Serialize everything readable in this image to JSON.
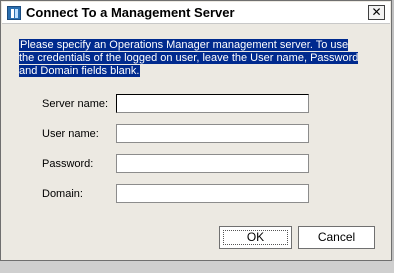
{
  "dialog": {
    "title": "Connect To a Management Server",
    "close_glyph": "✕",
    "instructions": "Please specify an Operations Manager management server. To use the credentials of the logged on user, leave the User name, Password and Domain fields blank."
  },
  "fields": {
    "server_name_label": "Server name:",
    "server_name_value": "",
    "user_name_label": "User name:",
    "user_name_value": "",
    "password_label": "Password:",
    "password_value": "",
    "domain_label": "Domain:",
    "domain_value": ""
  },
  "buttons": {
    "ok_label": "OK",
    "cancel_label": "Cancel"
  },
  "colors": {
    "instructions_highlight": "#002a8e",
    "window_background": "#ece9e2"
  }
}
